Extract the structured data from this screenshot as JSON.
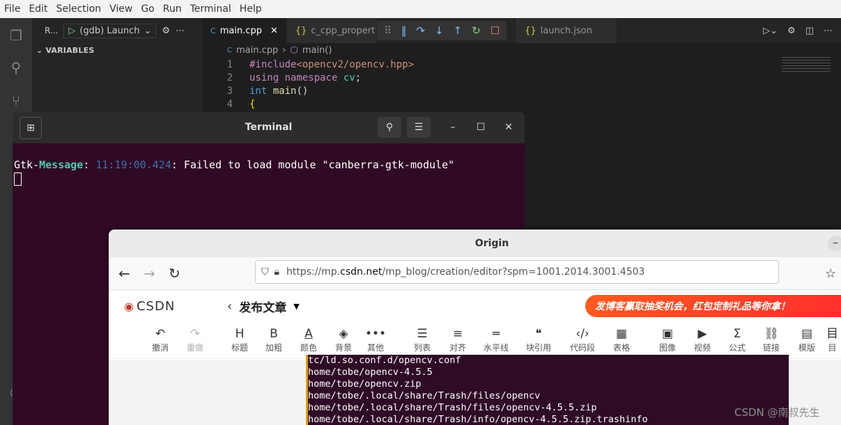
{
  "menubar": {
    "items": [
      "File",
      "Edit",
      "Selection",
      "View",
      "Go",
      "Run",
      "Terminal",
      "Help"
    ]
  },
  "run": {
    "panel_label": "R...",
    "launch_config": "(gdb) Launch",
    "variables_header": "VARIABLES"
  },
  "editor": {
    "tabs": [
      {
        "label": "main.cpp",
        "active": true
      },
      {
        "label": "c_cpp_propert"
      },
      {
        "label": "launch.json"
      }
    ],
    "breadcrumb": {
      "file": "main.cpp",
      "symbol": "main()"
    },
    "lines": [
      {
        "n": "1",
        "a": "#include",
        "b": "<opencv2/opencv.hpp>",
        "c": ""
      },
      {
        "n": "2",
        "a": "using namespace ",
        "b": "cv",
        "c": ";"
      },
      {
        "n": "3",
        "a": "int ",
        "b": "main",
        "c": "()"
      },
      {
        "n": "4",
        "a": "{",
        "b": "",
        "c": ""
      }
    ]
  },
  "terminal": {
    "title": "Terminal",
    "message": {
      "prefix": "Gtk-",
      "label": "Message",
      "colon": ": ",
      "time": "11:19:00.424",
      "text": ": Failed to load module \"canberra-gtk-module\""
    }
  },
  "origin": {
    "title": "Origin",
    "url": {
      "scheme": "https://mp.",
      "domain": "csdn.net",
      "path": "/mp_blog/creation/editor?spm=1001.2014.3001.4503"
    },
    "csdn": {
      "logo": "CSDN",
      "publish": "发布文章",
      "banner": "发博客赢取抽奖机会，红包定制礼品等你拿！"
    },
    "tools": [
      {
        "icon": "↶",
        "label": "撤消"
      },
      {
        "icon": "↷",
        "label": "重做"
      },
      {
        "icon": "H",
        "label": "标题"
      },
      {
        "icon": "B",
        "label": "加粗"
      },
      {
        "icon": "A",
        "label": "颜色"
      },
      {
        "icon": "◈",
        "label": "背景"
      },
      {
        "icon": "•••",
        "label": "其他"
      },
      {
        "icon": "☰",
        "label": "列表"
      },
      {
        "icon": "≡",
        "label": "对齐"
      },
      {
        "icon": "═",
        "label": "水平线"
      },
      {
        "icon": "❝",
        "label": "块引用"
      },
      {
        "icon": "‹/›",
        "label": "代码段"
      },
      {
        "icon": "▦",
        "label": "表格"
      },
      {
        "icon": "▣",
        "label": "图像"
      },
      {
        "icon": "▶",
        "label": "视频"
      },
      {
        "icon": "Σ",
        "label": "公式"
      },
      {
        "icon": "⛓",
        "label": "链接"
      },
      {
        "icon": "▤",
        "label": "模版"
      },
      {
        "icon": "目",
        "label": "目"
      }
    ],
    "content_lines": [
      "tc/ld.so.conf.d/opencv.conf",
      "home/tobe/opencv-4.5.5",
      "home/tobe/opencv.zip",
      "home/tobe/.local/share/Trash/files/opencv",
      "home/tobe/.local/share/Trash/files/opencv-4.5.5.zip",
      "home/tobe/.local/share/Trash/info/opencv-4.5.5.zip.trashinfo"
    ]
  },
  "watermark": "CSDN @南叔先生"
}
